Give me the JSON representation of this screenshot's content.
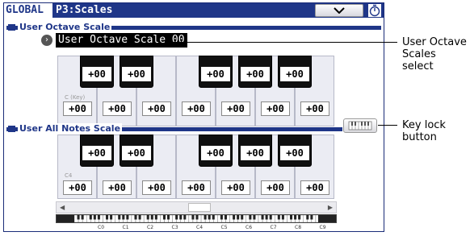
{
  "header": {
    "mode": "GLOBAL",
    "page_title": "P3:Scales",
    "menu_icon": "chevron-down-icon",
    "timer_icon": "stopwatch-icon"
  },
  "octave_section": {
    "title": "User Octave Scale",
    "select_value": "User Octave Scale 00",
    "select_icon": "circle-arrow-icon",
    "black_keys": [
      "+00",
      "+00",
      "+00",
      "+00",
      "+00"
    ],
    "white_key_label": "C (Key)",
    "white_keys": [
      "+00",
      "+00",
      "+00",
      "+00",
      "+00",
      "+00",
      "+00"
    ]
  },
  "all_notes_section": {
    "title": "User All Notes Scale",
    "black_keys": [
      "+00",
      "+00",
      "+00",
      "+00",
      "+00"
    ],
    "white_key_label": "C4",
    "white_keys": [
      "+00",
      "+00",
      "+00",
      "+00",
      "+00",
      "+00",
      "+00"
    ],
    "octave_labels": [
      "C0",
      "C1",
      "C2",
      "C3",
      "C4",
      "C5",
      "C6",
      "C7",
      "C8",
      "C9"
    ]
  },
  "callouts": {
    "select_line1": "User Octave",
    "select_line2": "Scales select",
    "keylock_line1": "Key lock",
    "keylock_line2": "button"
  },
  "colors": {
    "accent": "#1f3688",
    "key_bg": "#ebecf3"
  }
}
